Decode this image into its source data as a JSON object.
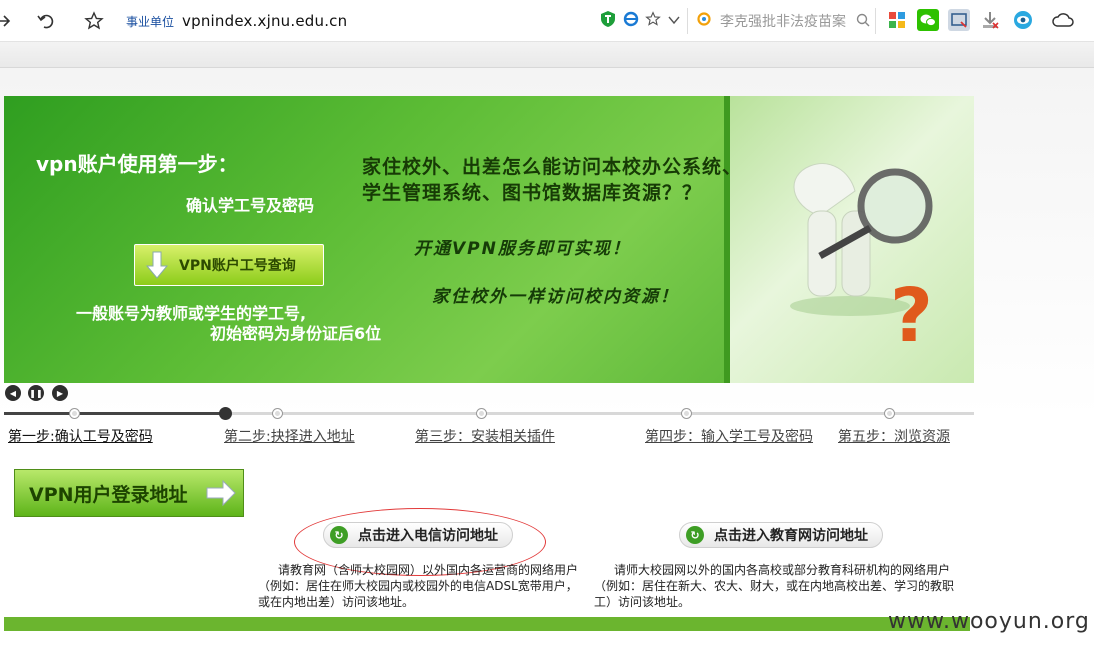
{
  "browser": {
    "address_tag": "事业单位",
    "url": "vpnindex.xjnu.edu.cn",
    "search_placeholder": "李克强批非法疫苗案"
  },
  "banner": {
    "title": "vpn账户使用第一步：",
    "subtitle": "确认学工号及密码",
    "query_button": "VPN账户工号查询",
    "note_line1": "一般账号为教师或学生的学工号,",
    "note_line2": "初始密码为身份证后6位",
    "question_line1": "家住校外、出差怎么能访问本校办公系统、",
    "question_line2": "学生管理系统、图书馆数据库资源？？",
    "headline1": "开通VPN服务即可实现！",
    "headline2": "家住校外一样访问校内资源！",
    "question_mark": "?"
  },
  "steps": [
    "第一步:确认工号及密码",
    "第二步:抉择进入地址",
    "第三步：安装相关插件",
    "第四步：输入学工号及密码",
    "第五步：浏览资源"
  ],
  "lower": {
    "vpn_login_label": "VPN用户登录地址",
    "telecom_button": "点击进入电信访问地址",
    "edu_button": "点击进入教育网访问地址",
    "telecom_desc": "请教育网（含师大校园网）以外国内各运营商的网络用户（例如：居住在师大校园内或校园外的电信ADSL宽带用户，或在内地出差）访问该地址。",
    "edu_desc": "请师大校园网以外的国内各高校或部分教育科研机构的网络用户（例如：居住在新大、农大、财大，或在内地高校出差、学习的教职工）访问该地址。"
  },
  "watermark": "www.wooyun.org",
  "colors": {
    "accent_green": "#5cbc35",
    "highlight_red": "#e23a3a"
  }
}
